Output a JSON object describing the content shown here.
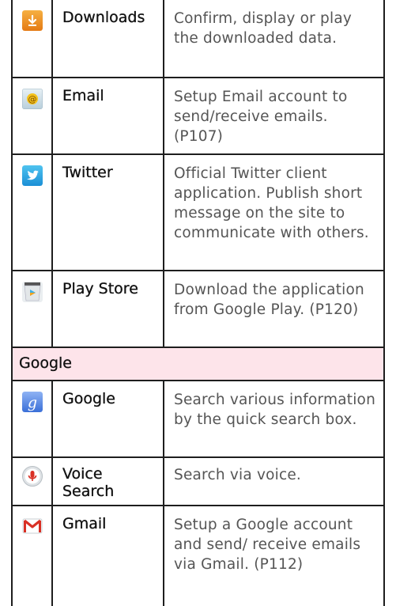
{
  "rows": [
    {
      "name": "Downloads",
      "desc": "Confirm, display or play the downloaded data.",
      "icon": "download-icon"
    },
    {
      "name": "Email",
      "desc": "Setup Email account to send/receive emails. (P107)",
      "icon": "email-icon"
    },
    {
      "name": "Twitter",
      "desc": "Official Twitter client application. Publish short message on the site to communicate with others.",
      "icon": "twitter-icon"
    },
    {
      "name": "Play Store",
      "desc": "Download the application from Google Play. (P120)",
      "icon": "play-store-icon"
    }
  ],
  "section": {
    "label": "Google"
  },
  "google_rows": [
    {
      "name": "Google",
      "desc": "Search various information by the quick search box.",
      "icon": "google-search-icon"
    },
    {
      "name": "Voice Search",
      "desc": "Search via voice.",
      "icon": "voice-search-icon"
    },
    {
      "name": "Gmail",
      "desc": "Setup a Google account and send/ receive emails via Gmail. (P112)",
      "icon": "gmail-icon"
    }
  ],
  "colors": {
    "section_bg": "#fde4ea",
    "border": "#1e1e1e",
    "desc_text": "#555555"
  }
}
